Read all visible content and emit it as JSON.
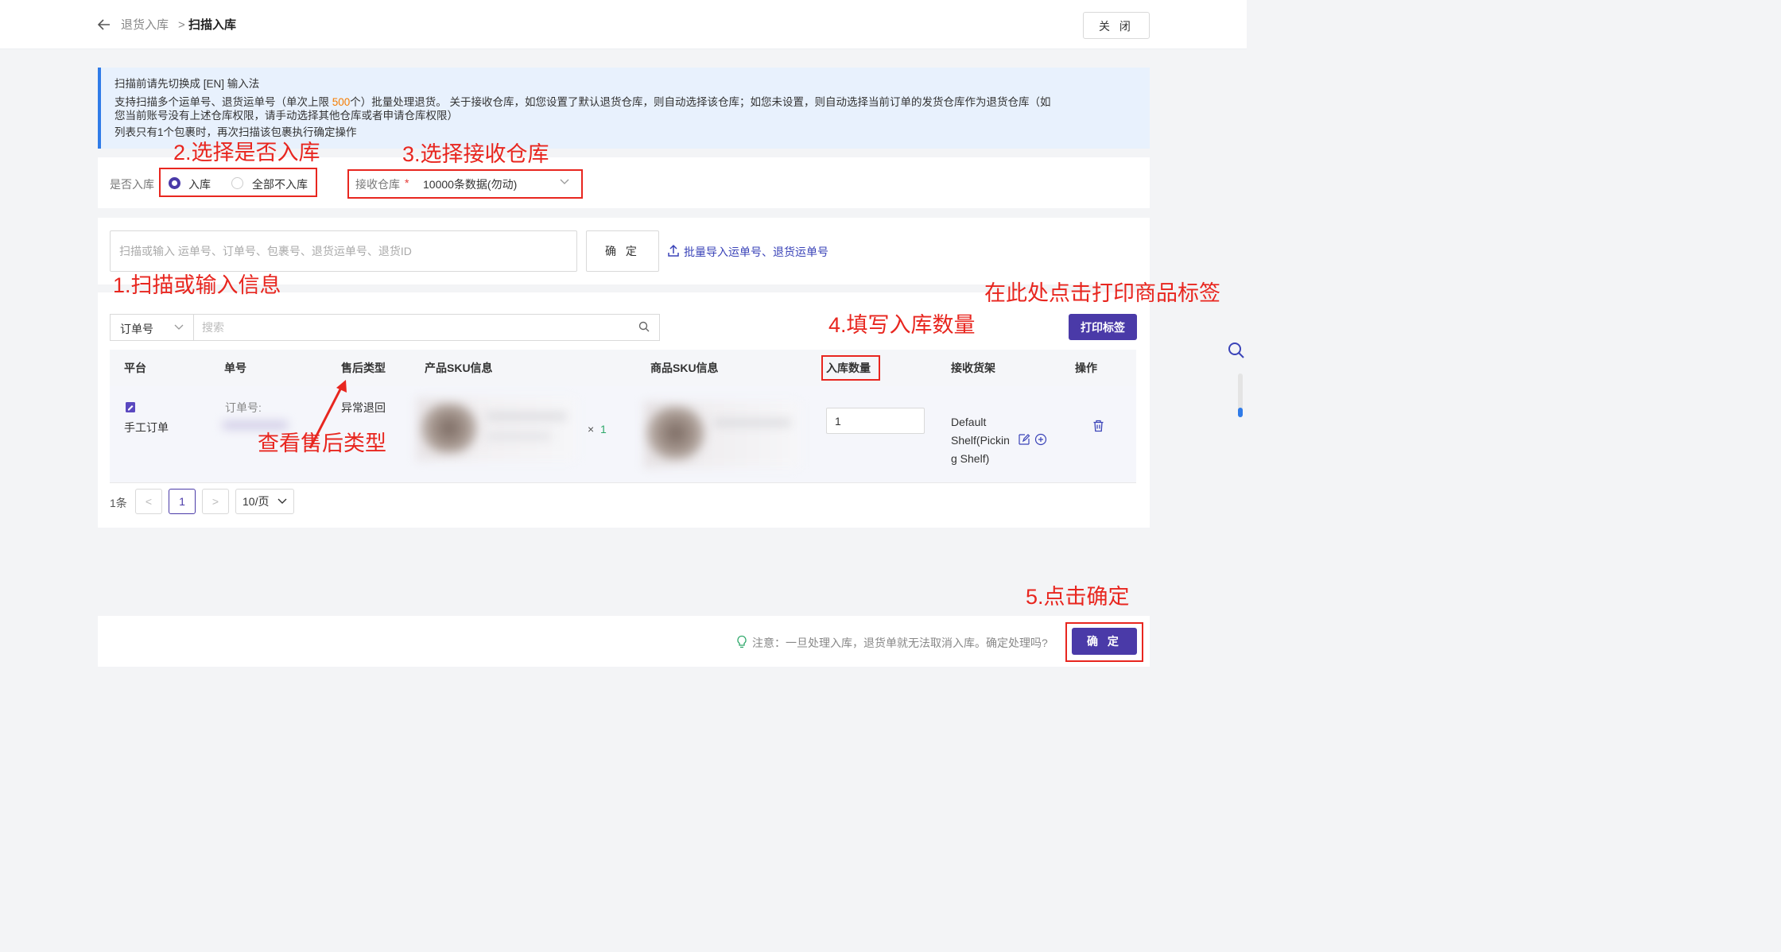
{
  "header": {
    "breadcrumb_parent": "退货入库",
    "breadcrumb_sep": ">",
    "breadcrumb_current": "扫描入库",
    "close_label": "关 闭"
  },
  "notice": {
    "line1": "扫描前请先切换成 [EN] 输入法",
    "line2_pre": "支持扫描多个运单号、退货运单号（单次上限 ",
    "line2_highlight": "500",
    "line2_post": "个）批量处理退货。 关于接收仓库，如您设置了默认退货仓库，则自动选择该仓库；如您未设置，则自动选择当前订单的发货仓库作为退货仓库（如",
    "line3": "您当前账号没有上述仓库权限，请手动选择其他仓库或者申请仓库权限）",
    "line4": "列表只有1个包裹时，再次扫描该包裹执行确定操作"
  },
  "options": {
    "stock_in_label": "是否入库",
    "radio_in": "入库",
    "radio_none": "全部不入库",
    "warehouse_label": "接收仓库",
    "warehouse_required": "*",
    "warehouse_value": "10000条数据(勿动)"
  },
  "scan": {
    "placeholder": "扫描或输入 运单号、订单号、包裹号、退货运单号、退货ID",
    "confirm_label": "确 定",
    "import_link": "批量导入运单号、退货运单号"
  },
  "filter": {
    "type_value": "订单号",
    "search_placeholder": "搜索",
    "print_label": "打印标签"
  },
  "table": {
    "headers": [
      "平台",
      "单号",
      "售后类型",
      "产品SKU信息",
      "商品SKU信息",
      "入库数量",
      "接收货架",
      "操作"
    ],
    "row": {
      "platform": "手工订单",
      "order_label": "订单号:",
      "aftersale_type": "异常退回",
      "multiply": "×",
      "qty": "1",
      "stock_in_qty": "1",
      "shelf_line1": "Default",
      "shelf_line2": "Shelf(Pickin",
      "shelf_line3": "g Shelf)"
    }
  },
  "pagination": {
    "total": "1条",
    "prev": "<",
    "current": "1",
    "next": ">",
    "page_size": "10/页"
  },
  "footer": {
    "note": "注意：一旦处理入库，退货单就无法取消入库。确定处理吗?",
    "confirm_label": "确 定"
  },
  "annotations": {
    "step1": "1.扫描或输入信息",
    "step2": "2.选择是否入库",
    "step3": "3.选择接收仓库",
    "step4": "4.填写入库数量",
    "step5": "5.点击确定",
    "print_hint": "在此处点击打印商品标签",
    "aftersale_hint": "查看售后类型"
  },
  "colors": {
    "primary": "#4a3aa8",
    "annotation": "#e8261f",
    "notice_bg": "#e8f1fd",
    "highlight": "#f57c00"
  }
}
